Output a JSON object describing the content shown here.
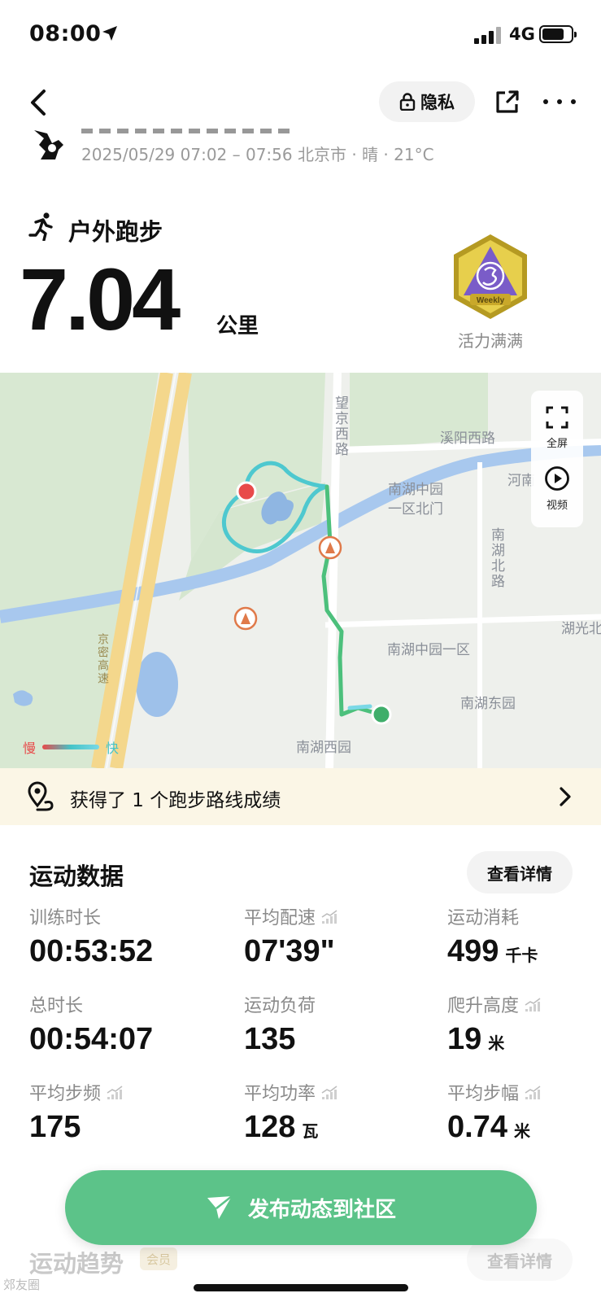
{
  "status_bar": {
    "time": "08:00",
    "network": "4G"
  },
  "header": {
    "privacy_label": "隐私"
  },
  "workout": {
    "meta": "2025/05/29 07:02 – 07:56 北京市 · 晴 · 21°C",
    "sport_title": "户外跑步",
    "distance": "7.04",
    "distance_unit": "公里",
    "medal_label": "活力满满",
    "medal_text": "Weekly"
  },
  "map": {
    "labels": {
      "wangjing": "望京西路",
      "xiyang": "溪阳西路",
      "henan": "河南",
      "nanhu_north_gate": "南湖中园一区北门",
      "nanhu_north_road": "南湖北路",
      "nanhu_zhongyuan": "南湖中园一区",
      "huguang": "湖光北",
      "nanhu_east": "南湖东园",
      "nanhu_west": "南湖西园",
      "jingmi": "京密高速"
    },
    "tools": {
      "fullscreen": "全屏",
      "video": "视频"
    },
    "legend": {
      "slow": "慢",
      "fast": "快"
    }
  },
  "achievement": {
    "text": "获得了 1 个跑步路线成绩"
  },
  "stats": {
    "section_title": "运动数据",
    "detail_button": "查看详情",
    "items": [
      {
        "label": "训练时长",
        "value": "00:53:52",
        "unit": ""
      },
      {
        "label": "平均配速",
        "value": "07'39\"",
        "unit": ""
      },
      {
        "label": "运动消耗",
        "value": "499",
        "unit": "千卡"
      },
      {
        "label": "总时长",
        "value": "00:54:07",
        "unit": ""
      },
      {
        "label": "运动负荷",
        "value": "135",
        "unit": ""
      },
      {
        "label": "爬升高度",
        "value": "19",
        "unit": "米"
      },
      {
        "label": "平均步频",
        "value": "175",
        "unit": ""
      },
      {
        "label": "平均功率",
        "value": "128",
        "unit": "瓦"
      },
      {
        "label": "平均步幅",
        "value": "0.74",
        "unit": "米"
      }
    ]
  },
  "trend": {
    "title": "运动趋势",
    "member_badge": "会员",
    "detail_button": "查看详情"
  },
  "publish_button": {
    "label": "发布动态到社区"
  },
  "watermark": "郊友圈"
}
